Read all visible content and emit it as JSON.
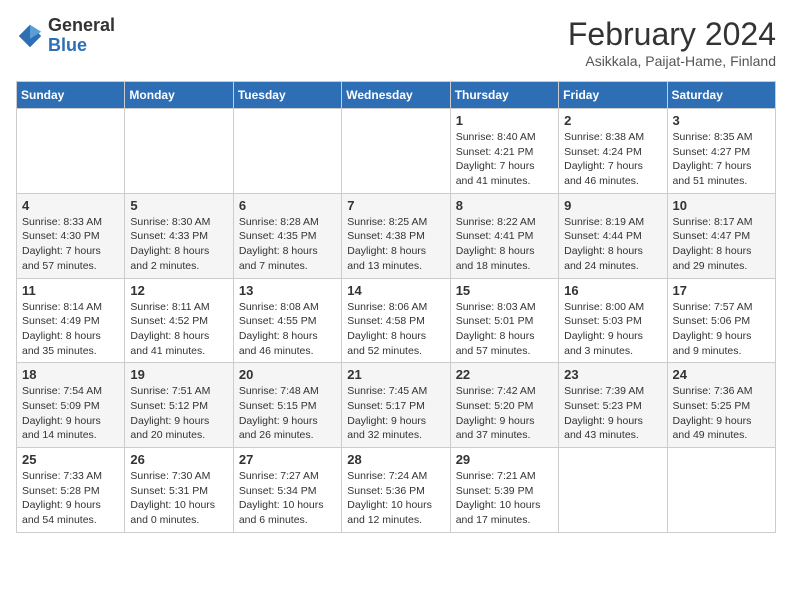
{
  "logo": {
    "general": "General",
    "blue": "Blue"
  },
  "title": "February 2024",
  "subtitle": "Asikkala, Paijat-Hame, Finland",
  "weekdays": [
    "Sunday",
    "Monday",
    "Tuesday",
    "Wednesday",
    "Thursday",
    "Friday",
    "Saturday"
  ],
  "weeks": [
    [
      {
        "day": "",
        "info": ""
      },
      {
        "day": "",
        "info": ""
      },
      {
        "day": "",
        "info": ""
      },
      {
        "day": "",
        "info": ""
      },
      {
        "day": "1",
        "info": "Sunrise: 8:40 AM\nSunset: 4:21 PM\nDaylight: 7 hours\nand 41 minutes."
      },
      {
        "day": "2",
        "info": "Sunrise: 8:38 AM\nSunset: 4:24 PM\nDaylight: 7 hours\nand 46 minutes."
      },
      {
        "day": "3",
        "info": "Sunrise: 8:35 AM\nSunset: 4:27 PM\nDaylight: 7 hours\nand 51 minutes."
      }
    ],
    [
      {
        "day": "4",
        "info": "Sunrise: 8:33 AM\nSunset: 4:30 PM\nDaylight: 7 hours\nand 57 minutes."
      },
      {
        "day": "5",
        "info": "Sunrise: 8:30 AM\nSunset: 4:33 PM\nDaylight: 8 hours\nand 2 minutes."
      },
      {
        "day": "6",
        "info": "Sunrise: 8:28 AM\nSunset: 4:35 PM\nDaylight: 8 hours\nand 7 minutes."
      },
      {
        "day": "7",
        "info": "Sunrise: 8:25 AM\nSunset: 4:38 PM\nDaylight: 8 hours\nand 13 minutes."
      },
      {
        "day": "8",
        "info": "Sunrise: 8:22 AM\nSunset: 4:41 PM\nDaylight: 8 hours\nand 18 minutes."
      },
      {
        "day": "9",
        "info": "Sunrise: 8:19 AM\nSunset: 4:44 PM\nDaylight: 8 hours\nand 24 minutes."
      },
      {
        "day": "10",
        "info": "Sunrise: 8:17 AM\nSunset: 4:47 PM\nDaylight: 8 hours\nand 29 minutes."
      }
    ],
    [
      {
        "day": "11",
        "info": "Sunrise: 8:14 AM\nSunset: 4:49 PM\nDaylight: 8 hours\nand 35 minutes."
      },
      {
        "day": "12",
        "info": "Sunrise: 8:11 AM\nSunset: 4:52 PM\nDaylight: 8 hours\nand 41 minutes."
      },
      {
        "day": "13",
        "info": "Sunrise: 8:08 AM\nSunset: 4:55 PM\nDaylight: 8 hours\nand 46 minutes."
      },
      {
        "day": "14",
        "info": "Sunrise: 8:06 AM\nSunset: 4:58 PM\nDaylight: 8 hours\nand 52 minutes."
      },
      {
        "day": "15",
        "info": "Sunrise: 8:03 AM\nSunset: 5:01 PM\nDaylight: 8 hours\nand 57 minutes."
      },
      {
        "day": "16",
        "info": "Sunrise: 8:00 AM\nSunset: 5:03 PM\nDaylight: 9 hours\nand 3 minutes."
      },
      {
        "day": "17",
        "info": "Sunrise: 7:57 AM\nSunset: 5:06 PM\nDaylight: 9 hours\nand 9 minutes."
      }
    ],
    [
      {
        "day": "18",
        "info": "Sunrise: 7:54 AM\nSunset: 5:09 PM\nDaylight: 9 hours\nand 14 minutes."
      },
      {
        "day": "19",
        "info": "Sunrise: 7:51 AM\nSunset: 5:12 PM\nDaylight: 9 hours\nand 20 minutes."
      },
      {
        "day": "20",
        "info": "Sunrise: 7:48 AM\nSunset: 5:15 PM\nDaylight: 9 hours\nand 26 minutes."
      },
      {
        "day": "21",
        "info": "Sunrise: 7:45 AM\nSunset: 5:17 PM\nDaylight: 9 hours\nand 32 minutes."
      },
      {
        "day": "22",
        "info": "Sunrise: 7:42 AM\nSunset: 5:20 PM\nDaylight: 9 hours\nand 37 minutes."
      },
      {
        "day": "23",
        "info": "Sunrise: 7:39 AM\nSunset: 5:23 PM\nDaylight: 9 hours\nand 43 minutes."
      },
      {
        "day": "24",
        "info": "Sunrise: 7:36 AM\nSunset: 5:25 PM\nDaylight: 9 hours\nand 49 minutes."
      }
    ],
    [
      {
        "day": "25",
        "info": "Sunrise: 7:33 AM\nSunset: 5:28 PM\nDaylight: 9 hours\nand 54 minutes."
      },
      {
        "day": "26",
        "info": "Sunrise: 7:30 AM\nSunset: 5:31 PM\nDaylight: 10 hours\nand 0 minutes."
      },
      {
        "day": "27",
        "info": "Sunrise: 7:27 AM\nSunset: 5:34 PM\nDaylight: 10 hours\nand 6 minutes."
      },
      {
        "day": "28",
        "info": "Sunrise: 7:24 AM\nSunset: 5:36 PM\nDaylight: 10 hours\nand 12 minutes."
      },
      {
        "day": "29",
        "info": "Sunrise: 7:21 AM\nSunset: 5:39 PM\nDaylight: 10 hours\nand 17 minutes."
      },
      {
        "day": "",
        "info": ""
      },
      {
        "day": "",
        "info": ""
      }
    ]
  ]
}
